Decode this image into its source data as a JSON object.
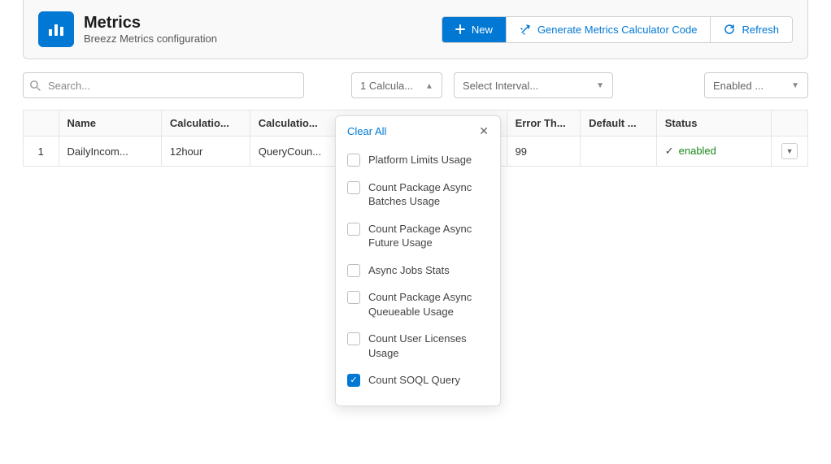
{
  "header": {
    "title": "Metrics",
    "subtitle": "Breezz Metrics configuration",
    "new_label": "New",
    "generate_label": "Generate Metrics Calculator Code",
    "refresh_label": "Refresh"
  },
  "filters": {
    "search_placeholder": "Search...",
    "calc_combo": "1 Calcula...",
    "interval_combo": "Select Interval...",
    "status_combo": "Enabled ..."
  },
  "table": {
    "headers": {
      "idx": "",
      "name": "Name",
      "calc1": "Calculatio...",
      "calc2": "Calculatio...",
      "err": "Error Th...",
      "def": "Default ...",
      "status": "Status",
      "act": ""
    },
    "row": {
      "idx": "1",
      "name": "DailyIncom...",
      "calc1": "12hour",
      "calc2": "QueryCoun...",
      "err": "99",
      "def": "",
      "status": "enabled"
    }
  },
  "dropdown": {
    "clear_all": "Clear All",
    "items": [
      {
        "label": "Platform Limits Usage",
        "checked": false
      },
      {
        "label": "Count Package Async Batches Usage",
        "checked": false
      },
      {
        "label": "Count Package Async Future Usage",
        "checked": false
      },
      {
        "label": "Async Jobs Stats",
        "checked": false
      },
      {
        "label": "Count Package Async Queueable Usage",
        "checked": false
      },
      {
        "label": "Count User Licenses Usage",
        "checked": false
      },
      {
        "label": "Count SOQL Query",
        "checked": true
      }
    ]
  }
}
